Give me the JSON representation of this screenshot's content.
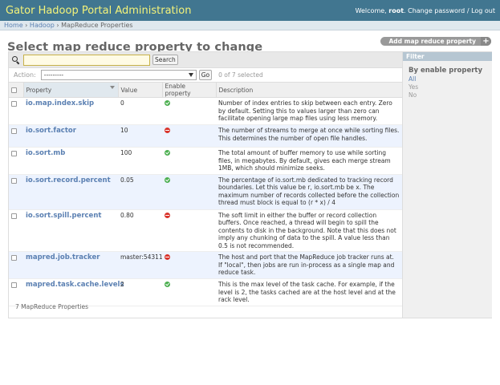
{
  "header": {
    "title": "Gator Hadoop Portal Administration",
    "welcome": "Welcome,",
    "username": "root",
    "change_password": "Change password",
    "separator": "/",
    "logout": "Log out"
  },
  "breadcrumbs": {
    "home": "Home",
    "app": "Hadoop",
    "model": "MapReduce Properties",
    "sep": "›"
  },
  "page": {
    "title": "Select map reduce property to change",
    "add_button": "Add map reduce property",
    "add_icon": "+"
  },
  "search": {
    "value": "",
    "button": "Search"
  },
  "actions": {
    "label": "Action:",
    "selected_option": "---------",
    "go_button": "Go",
    "counter": "0 of 7 selected"
  },
  "table": {
    "columns": [
      "Property",
      "Value",
      "Enable property",
      "Description"
    ],
    "rows": [
      {
        "property": "io.map.index.skip",
        "value": "0",
        "enabled": true,
        "description": "Number of index entries to skip between each entry. Zero by default. Setting this to values larger than zero can facilitate opening large map files using less memory."
      },
      {
        "property": "io.sort.factor",
        "value": "10",
        "enabled": false,
        "description": "The number of streams to merge at once while sorting files. This determines the number of open file handles."
      },
      {
        "property": "io.sort.mb",
        "value": "100",
        "enabled": true,
        "description": "The total amount of buffer memory to use while sorting files, in megabytes. By default, gives each merge stream 1MB, which should minimize seeks."
      },
      {
        "property": "io.sort.record.percent",
        "value": "0.05",
        "enabled": true,
        "description": "The percentage of io.sort.mb dedicated to tracking record boundaries. Let this value be r, io.sort.mb be x. The maximum number of records collected before the collection thread must block is equal to (r * x) / 4"
      },
      {
        "property": "io.sort.spill.percent",
        "value": "0.80",
        "enabled": false,
        "description": "The soft limit in either the buffer or record collection buffers. Once reached, a thread will begin to spill the contents to disk in the background. Note that this does not imply any chunking of data to the spill. A value less than 0.5 is not recommended."
      },
      {
        "property": "mapred.job.tracker",
        "value": "master:54311",
        "enabled": false,
        "description": "The host and port that the MapReduce job tracker runs at. If \"local\", then jobs are run in-process as a single map and reduce task."
      },
      {
        "property": "mapred.task.cache.levels",
        "value": "2",
        "enabled": true,
        "description": "This is the max level of the task cache. For example, if the level is 2, the tasks cached are at the host level and at the rack level."
      }
    ]
  },
  "paginator": "7 MapReduce Properties",
  "filter": {
    "heading": "Filter",
    "group": "By enable property",
    "options": [
      "All",
      "Yes",
      "No"
    ],
    "selected": "All"
  },
  "colors": {
    "header_bg": "#417690",
    "branding": "#f4f379",
    "link": "#5b80b2",
    "row_alt": "#edf3fe",
    "yes_icon": "#4caf50",
    "no_icon": "#d9342b"
  }
}
